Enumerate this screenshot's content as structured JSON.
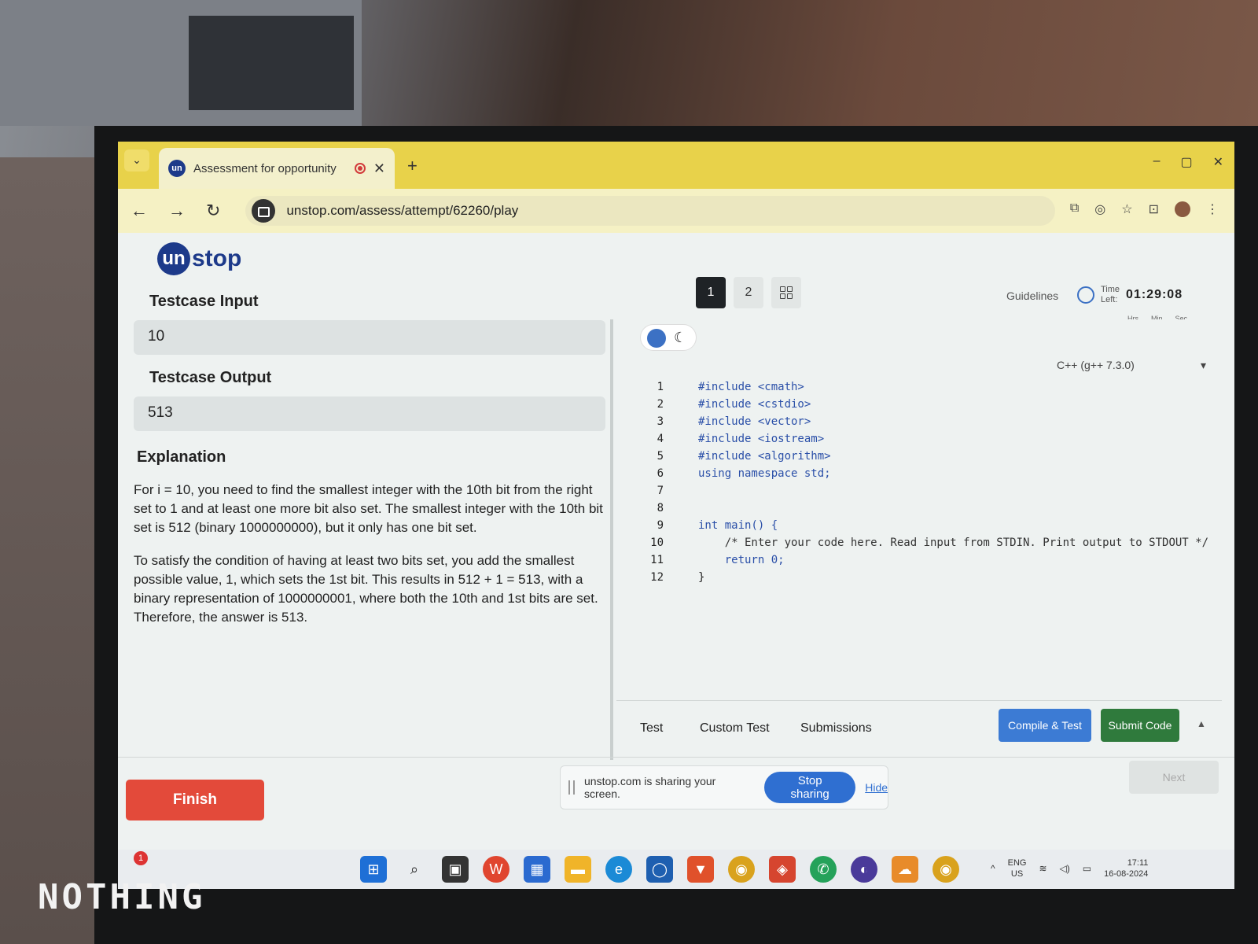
{
  "browser": {
    "tab_title": "Assessment for opportunity",
    "tab_close": "✕",
    "new_tab": "+",
    "url": "unstop.com/assess/attempt/62260/play",
    "win_min": "–",
    "win_max": "▢",
    "win_close": "✕"
  },
  "logo": {
    "mark": "un",
    "text": "stop"
  },
  "question_nav": {
    "q1": "1",
    "q2": "2"
  },
  "header": {
    "guidelines": "Guidelines",
    "time_label_1": "Time",
    "time_label_2": "Left:",
    "time_value": "01:29:08",
    "units": {
      "hrs": "Hrs",
      "min": "Min",
      "sec": "Sec"
    }
  },
  "testcase": {
    "input_label": "Testcase Input",
    "input_value": "10",
    "output_label": "Testcase Output",
    "output_value": "513"
  },
  "explanation": {
    "title": "Explanation",
    "para1": "For i = 10, you need to find the smallest integer with the 10th bit from the right set to 1 and at least one more bit also set. The smallest integer with the 10th bit set is 512 (binary 1000000000), but it only has one bit set.",
    "para2": "To satisfy the condition of having at least two bits set, you add the smallest possible value, 1, which sets the 1st bit. This results in 512 + 1 = 513, with a binary representation of 1000000001, where both the 10th and 1st bits are set. Therefore, the answer is 513."
  },
  "editor": {
    "language": "C++ (g++ 7.3.0)",
    "lines": [
      {
        "n": "1",
        "code": "#include <cmath>"
      },
      {
        "n": "2",
        "code": "#include <cstdio>"
      },
      {
        "n": "3",
        "code": "#include <vector>"
      },
      {
        "n": "4",
        "code": "#include <iostream>"
      },
      {
        "n": "5",
        "code": "#include <algorithm>"
      },
      {
        "n": "6",
        "code": "using namespace std;"
      },
      {
        "n": "7",
        "code": ""
      },
      {
        "n": "8",
        "code": ""
      },
      {
        "n": "9",
        "code": "int main() {"
      },
      {
        "n": "10",
        "code": "    /* Enter your code here. Read input from STDIN. Print output to STDOUT */"
      },
      {
        "n": "11",
        "code": "    return 0;"
      },
      {
        "n": "12",
        "code": "}"
      }
    ]
  },
  "tabs": {
    "test": "Test",
    "custom_test": "Custom Test",
    "submissions": "Submissions"
  },
  "buttons": {
    "compile": "Compile & Test",
    "submit": "Submit Code",
    "finish": "Finish",
    "next": "Next"
  },
  "share": {
    "text": "unstop.com is sharing your screen.",
    "stop": "Stop sharing",
    "hide": "Hide"
  },
  "taskbar": {
    "lang_1": "ENG",
    "lang_2": "US",
    "time": "17:11",
    "date": "16-08-2024",
    "notif_count": "1"
  },
  "watermark": "NOTHING"
}
